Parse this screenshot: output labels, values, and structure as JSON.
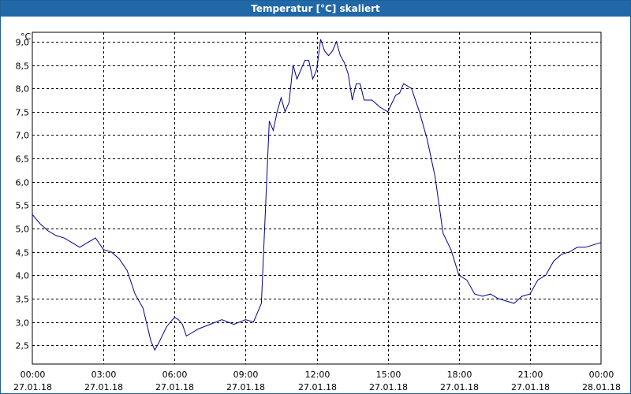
{
  "window": {
    "title": "Temperatur [°C] skaliert"
  },
  "chart_data": {
    "type": "line",
    "title": "Temperatur [°C] skaliert",
    "ylabel": "°C",
    "xlabel": "",
    "ylim": [
      2.1,
      9.2
    ],
    "y_ticks": [
      "9,0",
      "8,5",
      "8,0",
      "7,5",
      "7,0",
      "6,5",
      "6,0",
      "5,5",
      "5,0",
      "4,5",
      "4,0",
      "3,5",
      "3,0",
      "2,5"
    ],
    "x_ticks": [
      {
        "time": "00:00",
        "date": "27.01.18"
      },
      {
        "time": "03:00",
        "date": "27.01.18"
      },
      {
        "time": "06:00",
        "date": "27.01.18"
      },
      {
        "time": "09:00",
        "date": "27.01.18"
      },
      {
        "time": "12:00",
        "date": "27.01.18"
      },
      {
        "time": "15:00",
        "date": "27.01.18"
      },
      {
        "time": "18:00",
        "date": "27.01.18"
      },
      {
        "time": "21:00",
        "date": "27.01.18"
      },
      {
        "time": "00:00",
        "date": "28.01.18"
      }
    ],
    "grid": true,
    "line_color": "#00008b",
    "series": [
      {
        "x": [
          "27.01.18 00:00",
          "27.01.18 00:20",
          "27.01.18 00:40",
          "27.01.18 01:00",
          "27.01.18 01:20",
          "27.01.18 01:40",
          "27.01.18 02:00",
          "27.01.18 02:20",
          "27.01.18 02:40",
          "27.01.18 03:00",
          "27.01.18 03:20",
          "27.01.18 03:40",
          "27.01.18 04:00",
          "27.01.18 04:20",
          "27.01.18 04:40",
          "27.01.18 05:00",
          "27.01.18 05:10",
          "27.01.18 05:20",
          "27.01.18 05:40",
          "27.01.18 06:00",
          "27.01.18 06:10",
          "27.01.18 06:20",
          "27.01.18 06:30",
          "27.01.18 06:40",
          "27.01.18 07:00",
          "27.01.18 07:30",
          "27.01.18 08:00",
          "27.01.18 08:30",
          "27.01.18 09:00",
          "27.01.18 09:20",
          "27.01.18 09:40",
          "27.01.18 10:00",
          "27.01.18 10:10",
          "27.01.18 10:20",
          "27.01.18 10:30",
          "27.01.18 10:40",
          "27.01.18 10:50",
          "27.01.18 11:00",
          "27.01.18 11:10",
          "27.01.18 11:20",
          "27.01.18 11:30",
          "27.01.18 11:40",
          "27.01.18 11:50",
          "27.01.18 12:00",
          "27.01.18 12:10",
          "27.01.18 12:20",
          "27.01.18 12:30",
          "27.01.18 12:40",
          "27.01.18 12:50",
          "27.01.18 13:00",
          "27.01.18 13:10",
          "27.01.18 13:20",
          "27.01.18 13:30",
          "27.01.18 13:40",
          "27.01.18 13:50",
          "27.01.18 14:00",
          "27.01.18 14:20",
          "27.01.18 14:40",
          "27.01.18 15:00",
          "27.01.18 15:20",
          "27.01.18 15:30",
          "27.01.18 15:40",
          "27.01.18 16:00",
          "27.01.18 16:20",
          "27.01.18 16:40",
          "27.01.18 17:00",
          "27.01.18 17:20",
          "27.01.18 17:40",
          "27.01.18 18:00",
          "27.01.18 18:20",
          "27.01.18 18:40",
          "27.01.18 19:00",
          "27.01.18 19:20",
          "27.01.18 19:40",
          "27.01.18 20:00",
          "27.01.18 20:20",
          "27.01.18 20:40",
          "27.01.18 21:00",
          "27.01.18 21:20",
          "27.01.18 21:40",
          "27.01.18 22:00",
          "27.01.18 22:20",
          "27.01.18 22:40",
          "27.01.18 23:00",
          "27.01.18 23:20",
          "27.01.18 23:40",
          "28.01.18 00:00"
        ],
        "values": [
          5.3,
          5.1,
          4.95,
          4.85,
          4.8,
          4.7,
          4.6,
          4.7,
          4.8,
          4.55,
          4.5,
          4.35,
          4.1,
          3.6,
          3.3,
          2.6,
          2.4,
          2.55,
          2.9,
          3.1,
          3.05,
          2.95,
          2.7,
          2.75,
          2.85,
          2.95,
          3.05,
          2.95,
          3.05,
          3.0,
          3.4,
          7.3,
          7.1,
          7.5,
          7.8,
          7.5,
          7.7,
          8.5,
          8.2,
          8.4,
          8.6,
          8.6,
          8.2,
          8.4,
          9.05,
          8.8,
          8.7,
          8.8,
          9.0,
          8.7,
          8.55,
          8.3,
          7.75,
          8.1,
          8.1,
          7.75,
          7.75,
          7.6,
          7.5,
          7.85,
          7.9,
          8.1,
          8.0,
          7.5,
          6.9,
          6.1,
          4.9,
          4.55,
          4.0,
          3.9,
          3.6,
          3.55,
          3.6,
          3.5,
          3.45,
          3.4,
          3.55,
          3.6,
          3.9,
          4.0,
          4.3,
          4.45,
          4.5,
          4.6,
          4.6,
          4.65,
          4.7
        ]
      }
    ]
  }
}
